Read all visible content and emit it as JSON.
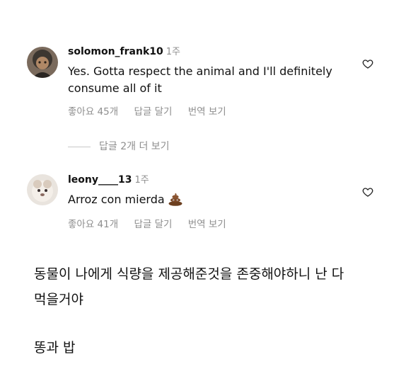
{
  "comments": [
    {
      "username": "solomon_frank10",
      "time": "1주",
      "text": "Yes. Gotta respect the animal and I'll definitely consume all of it",
      "likes": "좋아요 45개",
      "reply": "답글 달기",
      "translate": "번역 보기",
      "view_replies": "답글 2개 더 보기"
    },
    {
      "username": "leony____13",
      "time": "1주",
      "text": "Arroz con mierda",
      "emoji": "poop-icon",
      "likes": "좋아요 41개",
      "reply": "답글 달기",
      "translate": "번역 보기"
    }
  ],
  "translation": {
    "line1": "동물이 나에게 식량을 제공해준것을 존중해야하니 난 다",
    "line2": "먹을거야",
    "line3": "똥과 밥"
  },
  "colors": {
    "text": "#111111",
    "muted": "#8e8e8e",
    "background": "#ffffff"
  },
  "icons": [
    "heart-outline-icon",
    "poop-icon"
  ]
}
